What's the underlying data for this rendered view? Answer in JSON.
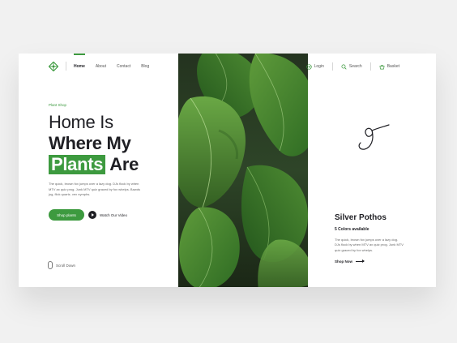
{
  "nav": {
    "items": [
      "Home",
      "About",
      "Contact",
      "Blog"
    ]
  },
  "header_right": {
    "login": "Login",
    "search": "Search",
    "basket": "Basket"
  },
  "hero": {
    "tag": "Plant Shop",
    "line1": "Home Is",
    "line2": "Where My",
    "highlight": "Plants",
    "line3_tail": "Are",
    "description": "The quick, brown fox jumps over a lazy dog. DJs flock by when MTV ax quiz prog. Junk MTV quiz graced by fox whelps. Bawds jog, flick quartz, vex nymphs.",
    "primary_cta": "Shop plants",
    "secondary_cta": "Watch Our Video",
    "scroll": "Scroll Down"
  },
  "product": {
    "title": "Silver Pothos",
    "subtitle": "5 Colors available",
    "description": "The quick, brown fox jumps over a lazy dog. DJs flock by when MTV ax quiz prog. Junk MTV quiz graced by fox whelps.",
    "cta": "Shop Now"
  },
  "colors": {
    "accent": "#3d9a3f",
    "dark": "#1f1f24"
  }
}
